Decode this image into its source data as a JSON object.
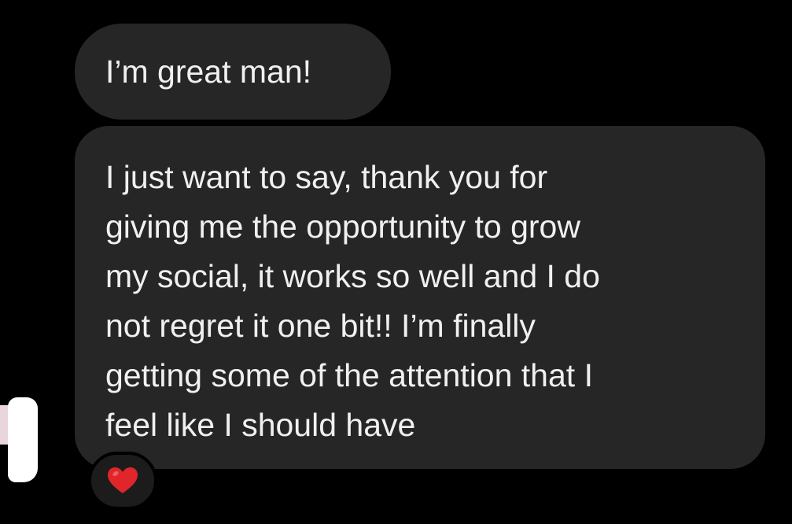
{
  "messages": [
    {
      "lines": [
        "I’m great man!"
      ]
    },
    {
      "lines": [
        "I just want to say, thank you for",
        "giving me the opportunity to grow",
        "my social, it works so well and I do",
        "not regret it one bit!! I’m finally",
        "getting some of the attention that I",
        "feel like I should have"
      ]
    }
  ],
  "reaction": {
    "icon": "red-heart-icon",
    "color": "#e0262b"
  },
  "colors": {
    "background": "#000000",
    "bubble": "#262626",
    "text": "#f0f0f0"
  }
}
